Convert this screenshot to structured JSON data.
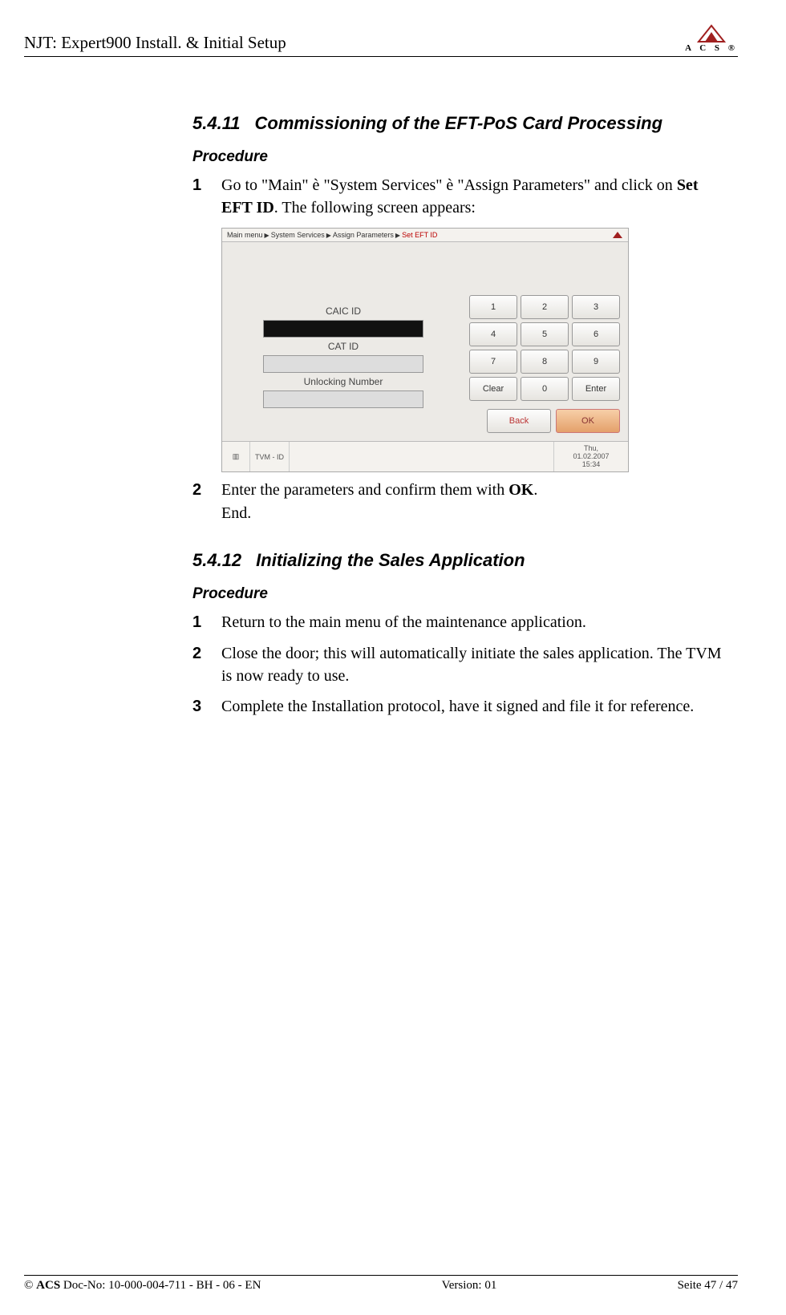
{
  "header": {
    "title": "NJT: Expert900 Install. & Initial Setup",
    "logo_text": "A  C  S ®"
  },
  "section1": {
    "number": "5.4.11",
    "title": "Commissioning of the EFT-PoS Card Processing",
    "procedure_label": "Procedure",
    "step1_num": "1",
    "step1_pre": "Go to \"Main\" ",
    "step1_arrow1": "è",
    "step1_mid1": " \"System Services\" ",
    "step1_arrow2": "è",
    "step1_mid2": " \"Assign Parameters\" and click on ",
    "step1_bold": "Set EFT ID",
    "step1_post": ". The following screen appears:",
    "step2_num": "2",
    "step2_pre": "Enter the parameters and confirm them with ",
    "step2_bold": "OK",
    "step2_post": ".",
    "step2_end": "End."
  },
  "screenshot": {
    "breadcrumb": {
      "p1": "Main menu",
      "p2": "System Services",
      "p3": "Assign Parameters",
      "p4": "Set EFT ID"
    },
    "labels": {
      "caic": "CAIC ID",
      "cat": "CAT ID",
      "unlock": "Unlocking Number"
    },
    "keys": {
      "k1": "1",
      "k2": "2",
      "k3": "3",
      "k4": "4",
      "k5": "5",
      "k6": "6",
      "k7": "7",
      "k8": "8",
      "k9": "9",
      "clear": "Clear",
      "k0": "0",
      "enter": "Enter"
    },
    "nav": {
      "back": "Back",
      "ok": "OK"
    },
    "status": {
      "tvm": "TVM - ID",
      "day": "Thu,",
      "date": "01.02.2007",
      "time": "15:34"
    }
  },
  "section2": {
    "number": "5.4.12",
    "title": "Initializing the Sales Application",
    "procedure_label": "Procedure",
    "step1_num": "1",
    "step1_text": "Return to the main menu of the maintenance application.",
    "step2_num": "2",
    "step2_text": "Close the door; this will automatically initiate the sales application. The TVM is now ready to use.",
    "step3_num": "3",
    "step3_text": "Complete the Installation protocol, have it signed and file it for reference."
  },
  "footer": {
    "copyright": "©",
    "org": "ACS",
    "doc": "  Doc-No: 10-000-004-711 - BH - 06 - EN",
    "version": "Version: 01",
    "page": "Seite 47 / 47"
  }
}
